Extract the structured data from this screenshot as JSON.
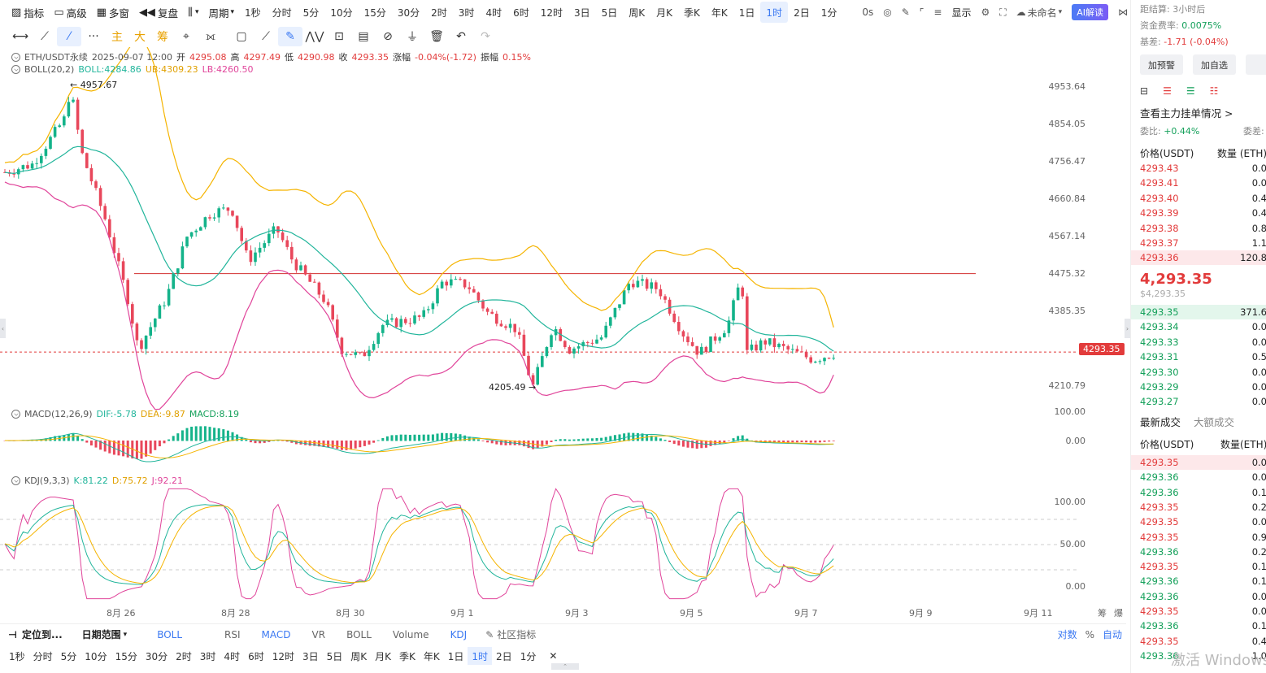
{
  "toolbar": {
    "indicators": "指标",
    "advanced": "高级",
    "multi_window": "多窗",
    "replay": "复盘",
    "period": "周期",
    "intervals": [
      "1秒",
      "分时",
      "5分",
      "10分",
      "15分",
      "30分",
      "2时",
      "3时",
      "4时",
      "6时",
      "12时",
      "3日",
      "5日",
      "周K",
      "月K",
      "季K",
      "年K",
      "1日",
      "1时",
      "2日",
      "1分"
    ],
    "active_interval": "1时",
    "countdown": "0s",
    "display": "显示",
    "unnamed": "未命名",
    "ai_read": "AI解读"
  },
  "drawing": {
    "main": "主",
    "big": "大",
    "chip": "筹"
  },
  "legend": {
    "symbol": "ETH/USDT永续",
    "time": "2025-09-07 12:00",
    "open_label": "开",
    "open": "4295.08",
    "high_label": "高",
    "high": "4297.49",
    "low_label": "低",
    "low": "4290.98",
    "close_label": "收",
    "close": "4293.35",
    "change_label": "涨幅",
    "change": "-0.04%(-1.72)",
    "amp_label": "振幅",
    "amp": "0.15%",
    "boll_name": "BOLL(20,2)",
    "boll": "BOLL:4284.86",
    "ub": "UB:4309.23",
    "lb": "LB:4260.50",
    "macd_name": "MACD(12,26,9)",
    "dif": "DIF:-5.78",
    "dea": "DEA:-9.87",
    "macd": "MACD:8.19",
    "kdj_name": "KDJ(9,3,3)",
    "k": "K:81.22",
    "d": "D:75.72",
    "j": "J:92.21"
  },
  "chart": {
    "high_marker": "4957.67",
    "low_marker": "4205.49",
    "current_price": "4293.35",
    "y_labels": [
      "4953.64",
      "4854.05",
      "4756.47",
      "4660.84",
      "4567.14",
      "4475.32",
      "4385.35",
      "4210.79"
    ],
    "macd_labels": [
      "100.00",
      "0.00"
    ],
    "kdj_labels": [
      "100.00",
      "50.00",
      "0.00"
    ],
    "x_labels": [
      "8月 26",
      "8月 28",
      "8月 30",
      "9月 1",
      "9月 3",
      "9月 5",
      "9月 7",
      "9月 9",
      "9月 11"
    ],
    "axis_right": [
      "筹",
      "爆"
    ],
    "colors": {
      "up": "#14b38a",
      "down": "#e8475b",
      "boll_mid": "#21b59b",
      "boll_up": "#f5b400",
      "boll_low": "#e0449a",
      "hline": "#d32f2f"
    }
  },
  "bottom": {
    "locate": "定位到...",
    "date_range": "日期范围",
    "indicators": [
      "BOLL",
      "RSI",
      "MACD",
      "VR",
      "BOLL",
      "Volume",
      "KDJ"
    ],
    "community": "社区指标",
    "log": "对数",
    "pct": "%",
    "auto": "自动",
    "intervals": [
      "1秒",
      "分时",
      "5分",
      "10分",
      "15分",
      "30分",
      "2时",
      "3时",
      "4时",
      "6时",
      "12时",
      "3日",
      "5日",
      "周K",
      "月K",
      "季K",
      "年K",
      "1日",
      "1时",
      "2日",
      "1分"
    ],
    "active_interval": "1时"
  },
  "panel": {
    "settle_label": "距结算:",
    "settle": "3小时后",
    "funding_label": "资金费率:",
    "funding": "0.0075%",
    "basis_label": "基差:",
    "basis": "-1.71 (-0.04%)",
    "btn_alert": "加预警",
    "btn_watch": "加自选",
    "main_orders": "查看主力挂单情况 >",
    "ratio_label": "委比:",
    "ratio": "+0.44%",
    "diff_label": "委差:",
    "price_hdr": "价格(USDT)",
    "qty_hdr": "数量 (ETH)",
    "asks": [
      [
        "4293.43",
        "0.0"
      ],
      [
        "4293.41",
        "0.0"
      ],
      [
        "4293.40",
        "0.4"
      ],
      [
        "4293.39",
        "0.4"
      ],
      [
        "4293.38",
        "0.8"
      ],
      [
        "4293.37",
        "1.1"
      ],
      [
        "4293.36",
        "120.8"
      ]
    ],
    "last": "4,293.35",
    "last_usd": "$4,293.35",
    "bids": [
      [
        "4293.35",
        "371.6"
      ],
      [
        "4293.34",
        "0.0"
      ],
      [
        "4293.33",
        "0.0"
      ],
      [
        "4293.31",
        "0.5"
      ],
      [
        "4293.30",
        "0.0"
      ],
      [
        "4293.29",
        "0.0"
      ],
      [
        "4293.27",
        "0.0"
      ]
    ],
    "tab_latest": "最新成交",
    "tab_large": "大额成交",
    "trade_price_hdr": "价格(USDT)",
    "trade_qty_hdr": "数量(ETH)",
    "trades": [
      [
        "4293.35",
        "0.0",
        "r"
      ],
      [
        "4293.36",
        "0.0",
        "g"
      ],
      [
        "4293.36",
        "0.1",
        "g"
      ],
      [
        "4293.35",
        "0.2",
        "r"
      ],
      [
        "4293.35",
        "0.0",
        "r"
      ],
      [
        "4293.35",
        "0.9",
        "r"
      ],
      [
        "4293.36",
        "0.2",
        "g"
      ],
      [
        "4293.35",
        "0.1",
        "r"
      ],
      [
        "4293.36",
        "0.1",
        "g"
      ],
      [
        "4293.36",
        "0.0",
        "g"
      ],
      [
        "4293.35",
        "0.0",
        "r"
      ],
      [
        "4293.36",
        "0.1",
        "g"
      ],
      [
        "4293.35",
        "0.4",
        "r"
      ],
      [
        "4293.36",
        "1.0",
        "g"
      ]
    ],
    "watermark": "激活 Windows"
  }
}
